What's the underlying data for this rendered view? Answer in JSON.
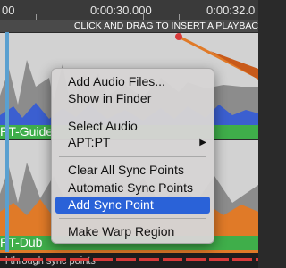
{
  "ruler": {
    "labels": [
      "00",
      "0:00:30.000",
      "0:00:32.0"
    ]
  },
  "hint": "CLICK AND DRAG TO INSERT A PLAYBAC",
  "tracks": [
    {
      "name": "PT-Guide"
    },
    {
      "name": "PT-Dub"
    }
  ],
  "footer": "l through sync points",
  "menu": {
    "items": [
      "Add Audio Files...",
      "Show in Finder",
      "Select Audio",
      "APT:PT",
      "Clear All Sync Points",
      "Automatic Sync Points",
      "Add Sync Point",
      "Make Warp Region"
    ],
    "highlighted": "Add Sync Point"
  },
  "colors": {
    "accent": "#2a62d8",
    "track_label_bg": "#3fae4a",
    "waveform_guide": "#3b5fd0",
    "waveform_dub": "#e07a28",
    "playhead": "#5aa0d0"
  }
}
